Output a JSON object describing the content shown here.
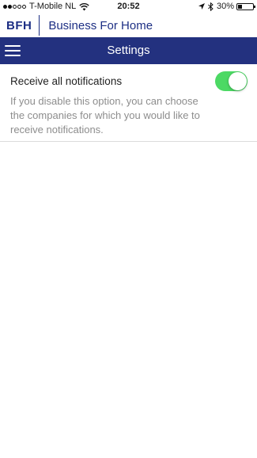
{
  "status_bar": {
    "carrier": "T-Mobile NL",
    "time": "20:52",
    "battery_percent": "30%",
    "battery_level": 0.3,
    "signal_bars_filled": 2,
    "signal_bars_total": 5
  },
  "brand": {
    "abbr": "BFH",
    "name": "Business For Home",
    "color": "#1d2f84"
  },
  "nav": {
    "title": "Settings",
    "menu_icon": "hamburger-menu-icon",
    "color": "#23317f"
  },
  "settings": {
    "notifications_label": "Receive all notifications",
    "notifications_description": "If you disable this option, you can choose the companies for which you would like to receive notifications.",
    "notifications_enabled": true,
    "toggle_on_color": "#4cd964"
  }
}
